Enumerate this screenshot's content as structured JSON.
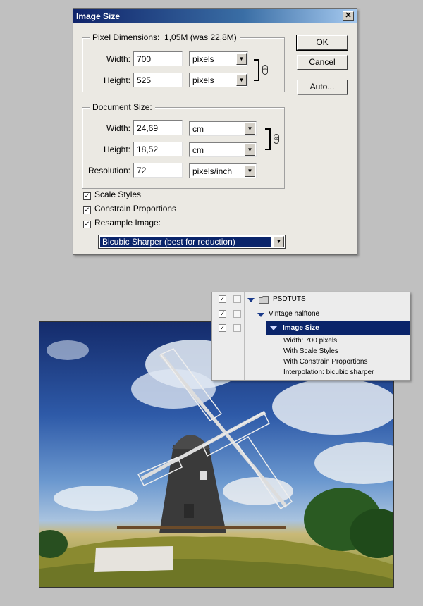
{
  "dialog": {
    "title": "Image Size",
    "close_glyph": "✕",
    "pixel_dimensions": {
      "legend": "Pixel Dimensions:",
      "size_info": "1,05M (was 22,8M)",
      "width_label": "Width:",
      "width_value": "700",
      "width_unit": "pixels",
      "height_label": "Height:",
      "height_value": "525",
      "height_unit": "pixels"
    },
    "document_size": {
      "legend": "Document Size:",
      "width_label": "Width:",
      "width_value": "24,69",
      "width_unit": "cm",
      "height_label": "Height:",
      "height_value": "18,52",
      "height_unit": "cm",
      "resolution_label": "Resolution:",
      "resolution_value": "72",
      "resolution_unit": "pixels/inch"
    },
    "checkboxes": {
      "scale_styles": "Scale Styles",
      "constrain_proportions": "Constrain Proportions",
      "resample_image": "Resample Image:"
    },
    "resample_method": "Bicubic Sharper (best for reduction)",
    "buttons": {
      "ok": "OK",
      "cancel": "Cancel",
      "auto": "Auto..."
    }
  },
  "actions_panel": {
    "set_name": "PSDTUTS",
    "action_name": "Vintage halftone",
    "step_name": "Image Size",
    "step_details": [
      "Width: 700 pixels",
      "With Scale Styles",
      "With Constrain Proportions",
      "Interpolation: bicubic sharper"
    ]
  },
  "photo": {
    "subject": "windmill"
  }
}
